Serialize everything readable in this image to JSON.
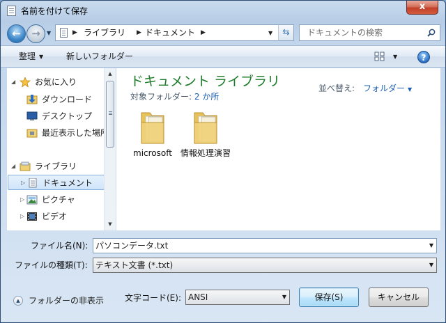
{
  "window": {
    "title": "名前を付けて保存",
    "close": "x"
  },
  "address": {
    "crumbs": [
      "ライブラリ",
      "ドキュメント"
    ],
    "search_placeholder": "ドキュメントの検索"
  },
  "toolbar": {
    "organize": "整理",
    "new_folder": "新しいフォルダー",
    "help": "?"
  },
  "nav": {
    "favorites": "お気に入り",
    "downloads": "ダウンロード",
    "desktop": "デスクトップ",
    "recent": "最近表示した場所",
    "libraries": "ライブラリ",
    "documents": "ドキュメント",
    "pictures": "ピクチャ",
    "videos": "ビデオ"
  },
  "content": {
    "library_title": "ドキュメント ライブラリ",
    "target_label": "対象フォルダー:",
    "target_link": "2 か所",
    "sort_label": "並べ替え:",
    "sort_value": "フォルダー",
    "items": [
      "microsoft",
      "情報処理演習"
    ]
  },
  "form": {
    "filename_label": "ファイル名(N):",
    "filename_value": "パソコンデータ.txt",
    "filetype_label": "ファイルの種類(T):",
    "filetype_value": "テキスト文書 (*.txt)",
    "encoding_label": "文字コード(E):",
    "encoding_value": "ANSI",
    "save": "保存(S)",
    "cancel": "キャンセル",
    "hide_folders": "フォルダーの非表示"
  },
  "colors": {
    "library_title": "#1e7c2b",
    "link": "#1a5fb4"
  }
}
